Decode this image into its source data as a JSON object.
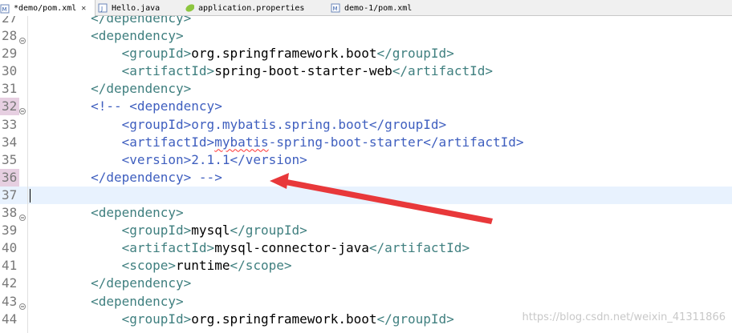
{
  "tabs": [
    {
      "label": "*demo/pom.xml",
      "icon": "xml-file-icon",
      "active": true
    },
    {
      "label": "Hello.java",
      "icon": "java-file-icon"
    },
    {
      "label": "application.properties",
      "icon": "properties-file-icon"
    },
    {
      "label": "demo-1/pom.xml",
      "icon": "xml-file-icon"
    }
  ],
  "lines": [
    {
      "n": "27",
      "code": "        </dependency>"
    },
    {
      "n": "28",
      "code": "        <dependency>"
    },
    {
      "n": "29",
      "code": "            <groupId>org.springframework.boot</groupId>"
    },
    {
      "n": "30",
      "code": "            <artifactId>spring-boot-starter-web</artifactId>"
    },
    {
      "n": "31",
      "code": "        </dependency>"
    },
    {
      "n": "32",
      "code": "        <!-- <dependency>"
    },
    {
      "n": "33",
      "code": "            <groupId>org.mybatis.spring.boot</groupId>"
    },
    {
      "n": "34",
      "code": "            <artifactId>mybatis-spring-boot-starter</artifactId>"
    },
    {
      "n": "35",
      "code": "            <version>2.1.1</version>"
    },
    {
      "n": "36",
      "code": "        </dependency> -->"
    },
    {
      "n": "37",
      "code": ""
    },
    {
      "n": "38",
      "code": "        <dependency>"
    },
    {
      "n": "39",
      "code": "            <groupId>mysql</groupId>"
    },
    {
      "n": "40",
      "code": "            <artifactId>mysql-connector-java</artifactId>"
    },
    {
      "n": "41",
      "code": "            <scope>runtime</scope>"
    },
    {
      "n": "42",
      "code": "        </dependency>"
    },
    {
      "n": "43",
      "code": "        <dependency>"
    },
    {
      "n": "44",
      "code": "            <groupId>org.springframework.boot</groupId>"
    }
  ],
  "watermark": "https://blog.csdn.net/weixin_41311866",
  "colors": {
    "tag": "#3f7f7f",
    "comment": "#3f5fbf",
    "text": "#000000",
    "arrow": "#e8383a",
    "current_line": "#e8f2fe"
  }
}
